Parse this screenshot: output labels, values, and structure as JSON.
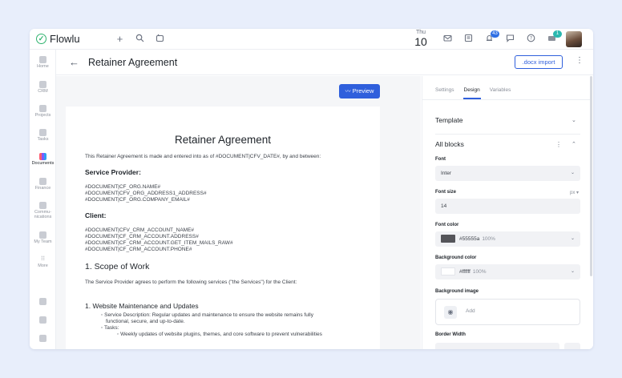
{
  "app": {
    "name": "Flowlu"
  },
  "topbar": {
    "date_dow": "Thu",
    "date_day": "10",
    "notifications_badge": "43",
    "apps_badge": "1"
  },
  "nav": {
    "items": [
      {
        "label": "Home"
      },
      {
        "label": "CRM"
      },
      {
        "label": "Projects"
      },
      {
        "label": "Tasks"
      },
      {
        "label": "Documents"
      },
      {
        "label": "Finance"
      },
      {
        "label": "Commu-\nnications"
      },
      {
        "label": "My Team"
      },
      {
        "label": "More"
      }
    ]
  },
  "header": {
    "back_icon": "←",
    "title": "Retainer Agreement",
    "docx_import": ".docx import"
  },
  "document": {
    "preview_label": "Preview",
    "title": "Retainer Agreement",
    "intro": "This Retainer Agreement is made and entered into as of #DOCUMENT|CFV_DATE#, by and between:",
    "service_provider_heading": "Service Provider:",
    "service_provider_lines": [
      "#DOCUMENT|CF_ORG.NAME#",
      "#DOCUMENT|CFV_ORG_ADDRESS1_ADDRESS#",
      "#DOCUMENT|CF_ORG.COMPANY_EMAIL#"
    ],
    "client_heading": "Client:",
    "client_lines": [
      "#DOCUMENT|CFV_CRM_ACCOUNT_NAME#",
      "#DOCUMENT|CF_CRM_ACCOUNT.ADDRESS#",
      "#DOCUMENT|CF_CRM_ACCOUNT.GET_ITEM_MAILS_RAW#",
      "#DOCUMENT|CF_CRM_ACCOUNT.PHONE#"
    ],
    "scope_heading": "1. Scope of Work",
    "scope_text": "The Service Provider agrees to perform the following services (\"the Services\") for the Client:",
    "sub_heading": "1. Website Maintenance and Updates",
    "bullet_1a": "Service Description: Regular updates and maintenance to ensure the website remains fully",
    "bullet_1b": "functional, secure, and up-to-date.",
    "bullet_2": "Tasks:",
    "bullet_3": "Weekly updates of website plugins, themes, and core software to prevent vulnerabilities"
  },
  "panel": {
    "tabs": [
      "Settings",
      "Design",
      "Variables"
    ],
    "template_label": "Template",
    "all_blocks_label": "All blocks",
    "font_label": "Font",
    "font_value": "Inter",
    "font_size_label": "Font size",
    "font_size_unit": "px",
    "font_size_value": "14",
    "font_color_label": "Font color",
    "font_color_value": "#55555a",
    "font_color_opacity": "100%",
    "bg_color_label": "Background color",
    "bg_color_value": "#ffffff",
    "bg_color_opacity": "100%",
    "bg_image_label": "Background image",
    "bg_image_add": "Add",
    "border_width_label": "Border Width"
  },
  "colors": {
    "accent": "#2f5fdc",
    "brand_green": "#2fb36e",
    "font_swatch": "#55555a",
    "bg_swatch": "#ffffff"
  }
}
